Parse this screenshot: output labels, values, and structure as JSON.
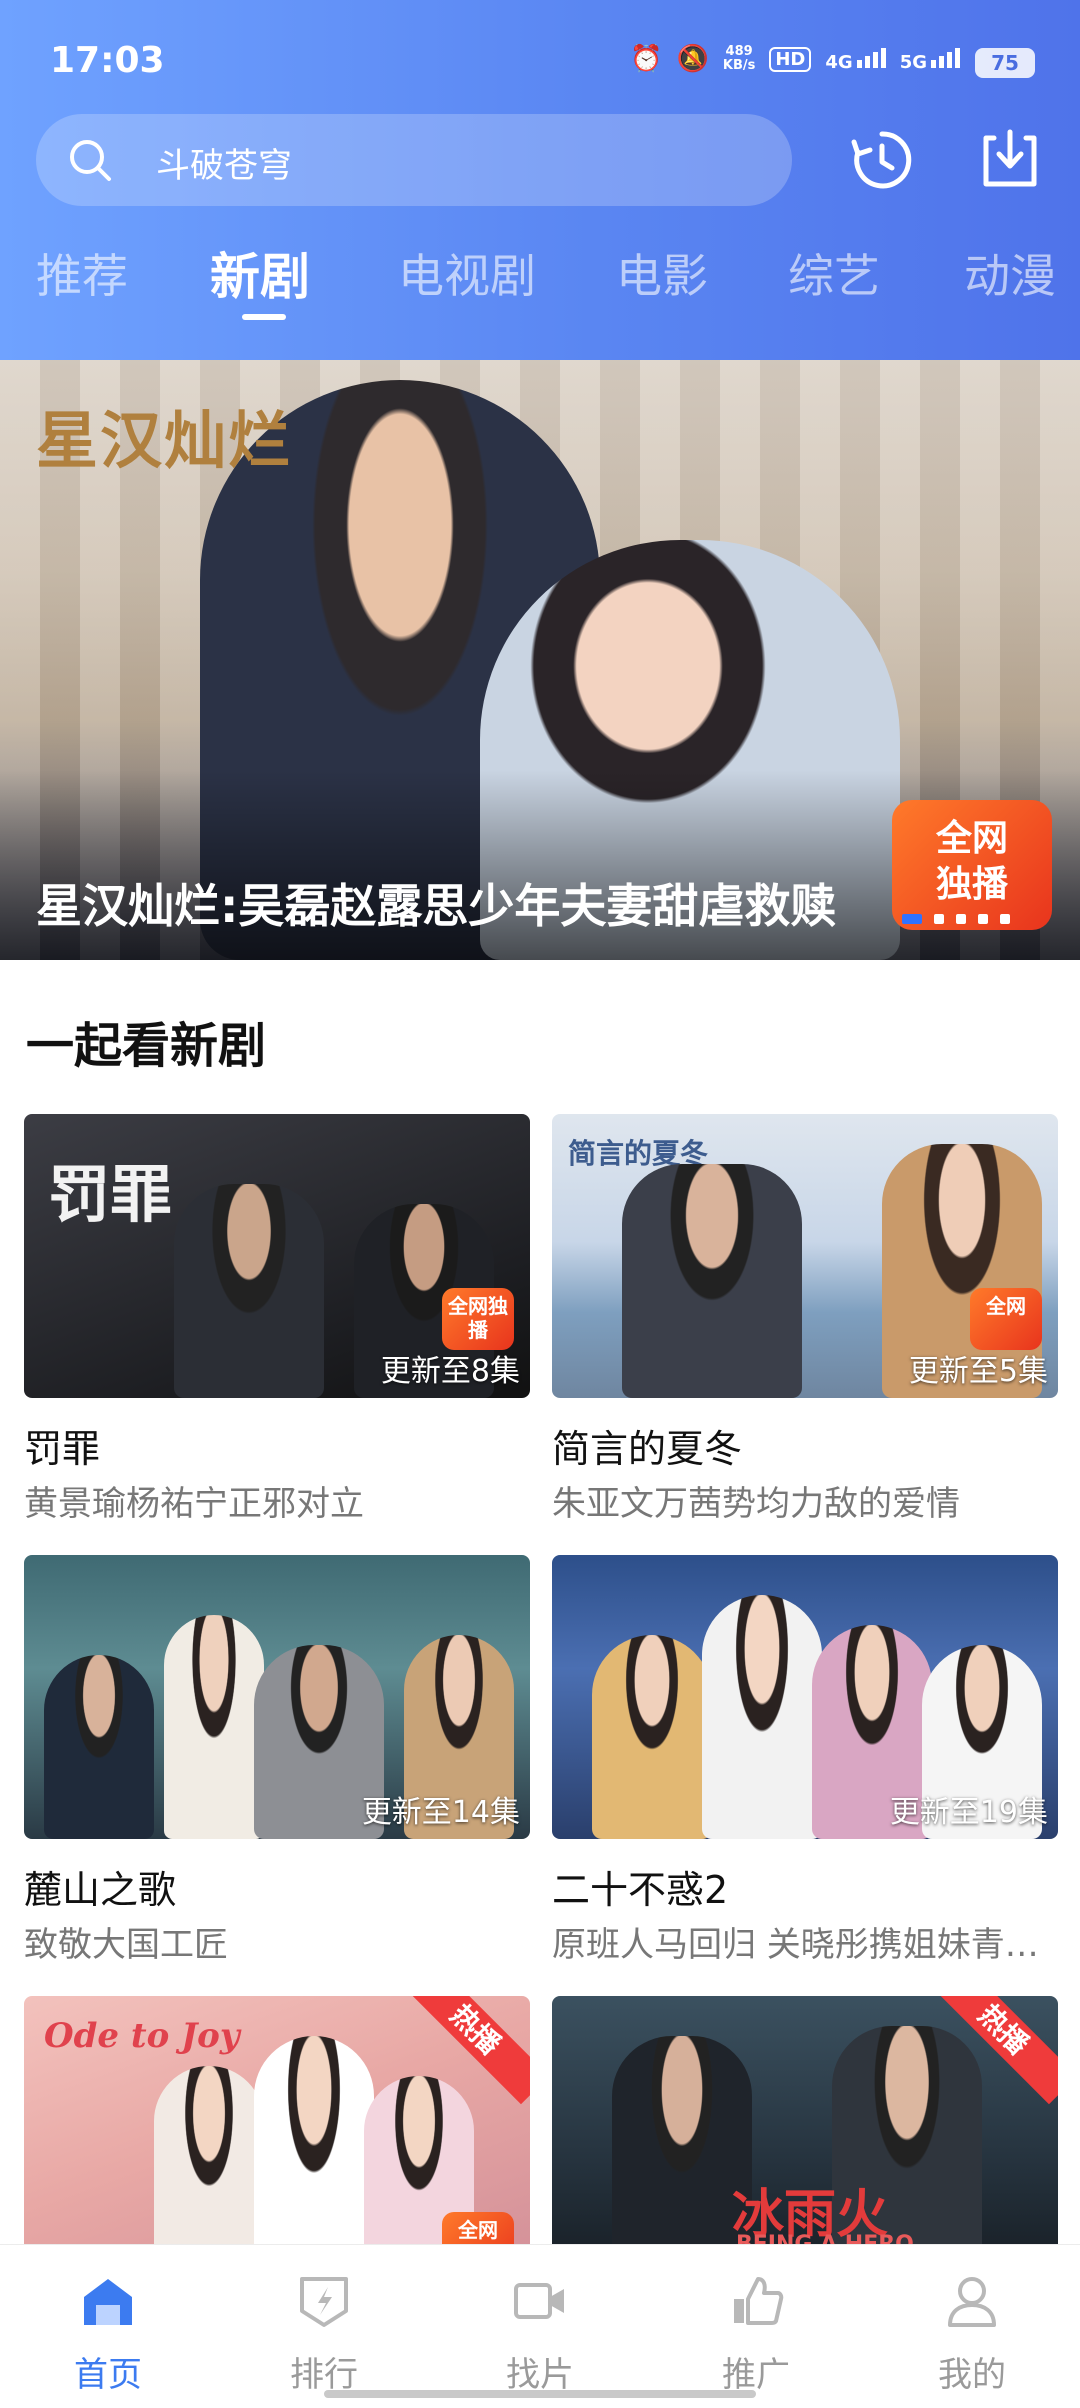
{
  "status_bar": {
    "time": "17:03",
    "net_speed_value": "489",
    "net_speed_unit": "KB/s",
    "hd_label": "HD",
    "signal_1": "4G",
    "signal_2": "5G",
    "battery": "75"
  },
  "search": {
    "placeholder": "斗破苍穹",
    "icon": "search-icon"
  },
  "header_actions": [
    "history-icon",
    "download-icon"
  ],
  "tabs": [
    {
      "label": "推荐",
      "active": false
    },
    {
      "label": "新剧",
      "active": true
    },
    {
      "label": "电视剧",
      "active": false
    },
    {
      "label": "电影",
      "active": false
    },
    {
      "label": "综艺",
      "active": false
    },
    {
      "label": "动漫",
      "active": false
    }
  ],
  "banner": {
    "logo": "星汉灿烂",
    "caption": "星汉灿烂:吴磊赵露思少年夫妻甜虐救赎",
    "badge_line1": "全网",
    "badge_line2": "独播",
    "pages": 5,
    "current_page": 1
  },
  "section": {
    "title": "一起看新剧"
  },
  "cards": [
    {
      "title": "罚罪",
      "subtitle": "黄景瑜杨祐宁正邪对立",
      "update": "更新至8集",
      "logo": "罚罪",
      "tag": "全网独播"
    },
    {
      "title": "简言的夏冬",
      "subtitle": "朱亚文万茜势均力敌的爱情",
      "update": "更新至5集",
      "logo": "简言的夏冬",
      "tag": "全网"
    },
    {
      "title": "麓山之歌",
      "subtitle": "致敬大国工匠",
      "update": "更新至14集"
    },
    {
      "title": "二十不惑2",
      "subtitle": "原班人马回归 关晓彤携姐妹青…",
      "update": "更新至19集"
    },
    {
      "hot": "热播",
      "logo": "Ode to Joy",
      "tag": "全网"
    },
    {
      "hot": "热播",
      "logo": "冰雨火",
      "logo_sub": "BEING A HERO"
    }
  ],
  "bottom_nav": [
    {
      "label": "首页",
      "icon": "home-icon",
      "active": true
    },
    {
      "label": "排行",
      "icon": "ranking-icon",
      "active": false
    },
    {
      "label": "找片",
      "icon": "video-camera-icon",
      "active": false
    },
    {
      "label": "推广",
      "icon": "thumbs-up-icon",
      "active": false
    },
    {
      "label": "我的",
      "icon": "profile-icon",
      "active": false
    }
  ],
  "colors": {
    "header_start": "#6fa2ff",
    "header_end": "#4f73ea",
    "accent": "#3c7bf0",
    "hot_tag": "#ef3b3b"
  }
}
